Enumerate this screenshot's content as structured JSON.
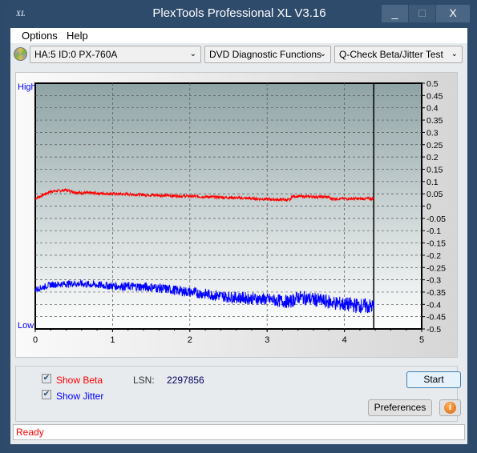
{
  "window": {
    "title": "PlexTools Professional XL V3.16",
    "logo": "XL",
    "minimize": "_",
    "maximize": "□",
    "close": "X"
  },
  "menu": {
    "items": [
      "Options",
      "Help"
    ]
  },
  "toolbar": {
    "drive": "HA:5 ID:0  PX-760A",
    "function": "DVD Diagnostic Functions",
    "test": "Q-Check Beta/Jitter Test",
    "drive_icon": "disc-icon"
  },
  "chart_data": {
    "type": "line",
    "left_labels": {
      "top": "High",
      "bottom": "Low"
    },
    "xlim": [
      0,
      5
    ],
    "ylim": [
      -0.5,
      0.5
    ],
    "x_ticks": [
      "0",
      "1",
      "2",
      "3",
      "4",
      "5"
    ],
    "y_ticks": [
      "0.5",
      "0.45",
      "0.4",
      "0.35",
      "0.3",
      "0.25",
      "0.2",
      "0.15",
      "0.1",
      "0.05",
      "0",
      "-0.05",
      "-0.1",
      "-0.15",
      "-0.2",
      "-0.25",
      "-0.3",
      "-0.35",
      "-0.4",
      "-0.45",
      "-0.5"
    ],
    "grid": true,
    "end_marker_x": 4.38,
    "series": [
      {
        "color": "#ff0000",
        "x": [
          0,
          0.1,
          0.2,
          0.4,
          0.55,
          1.0,
          1.5,
          2.0,
          2.5,
          3.0,
          3.3,
          3.32,
          3.8,
          3.82,
          4.38
        ],
        "y": [
          0.03,
          0.045,
          0.06,
          0.065,
          0.055,
          0.05,
          0.045,
          0.04,
          0.035,
          0.028,
          0.025,
          0.04,
          0.037,
          0.03,
          0.03
        ]
      },
      {
        "color": "#0000ff",
        "x": [
          0,
          0.2,
          0.5,
          1.0,
          1.5,
          2.0,
          2.5,
          3.0,
          3.3,
          3.4,
          3.8,
          4.0,
          4.38
        ],
        "y": [
          -0.34,
          -0.32,
          -0.315,
          -0.325,
          -0.33,
          -0.35,
          -0.37,
          -0.38,
          -0.39,
          -0.37,
          -0.39,
          -0.4,
          -0.41
        ]
      }
    ]
  },
  "controls": {
    "show_beta": "Show Beta",
    "show_jitter": "Show Jitter",
    "beta_checked": true,
    "jitter_checked": true,
    "lsn_label": "LSN:",
    "lsn_value": "2297856",
    "start": "Start",
    "preferences": "Preferences",
    "info_icon": "info-icon",
    "beta_color": "#ff0000",
    "jitter_color": "#0000ff"
  },
  "status": "Ready"
}
